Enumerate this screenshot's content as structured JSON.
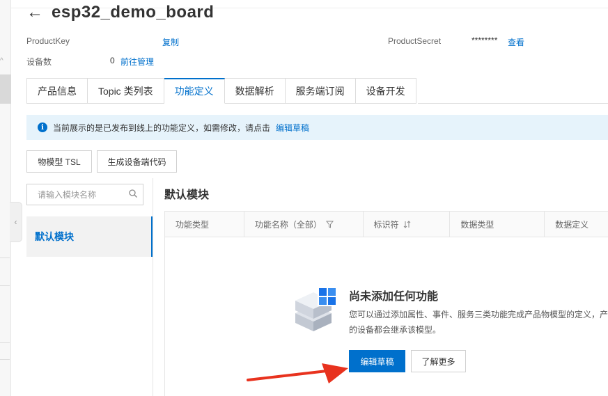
{
  "header": {
    "title": "esp32_demo_board"
  },
  "meta": {
    "product_key_label": "ProductKey",
    "product_key_copy": "复制",
    "device_count_label": "设备数",
    "device_count_value": "0",
    "device_manage_link": "前往管理",
    "product_secret_label": "ProductSecret",
    "product_secret_value": "********",
    "product_secret_view": "查看"
  },
  "tabs": [
    {
      "label": "产品信息"
    },
    {
      "label": "Topic 类列表"
    },
    {
      "label": "功能定义",
      "active": true
    },
    {
      "label": "数据解析"
    },
    {
      "label": "服务端订阅"
    },
    {
      "label": "设备开发"
    }
  ],
  "notice": {
    "text": "当前展示的是已发布到线上的功能定义，如需修改，请点击",
    "link": "编辑草稿"
  },
  "toolbar": {
    "tsl_button": "物模型 TSL",
    "gen_code_button": "生成设备端代码"
  },
  "modules": {
    "search_placeholder": "请输入模块名称",
    "items": [
      {
        "label": "默认模块",
        "selected": true
      }
    ]
  },
  "section": {
    "title": "默认模块"
  },
  "table": {
    "columns": [
      "功能类型",
      "功能名称（全部）",
      "标识符",
      "数据类型",
      "数据定义"
    ]
  },
  "empty": {
    "title": "尚未添加任何功能",
    "desc_line1": "您可以通过添加属性、事件、服务三类功能完成产品物模型的定义，产品",
    "desc_line2": "的设备都会继承该模型。",
    "edit_draft_button": "编辑草稿",
    "learn_more_button": "了解更多"
  },
  "colors": {
    "accent": "#0070cc",
    "notice_bg": "#e6f3fb",
    "arrow": "#e8321e"
  }
}
